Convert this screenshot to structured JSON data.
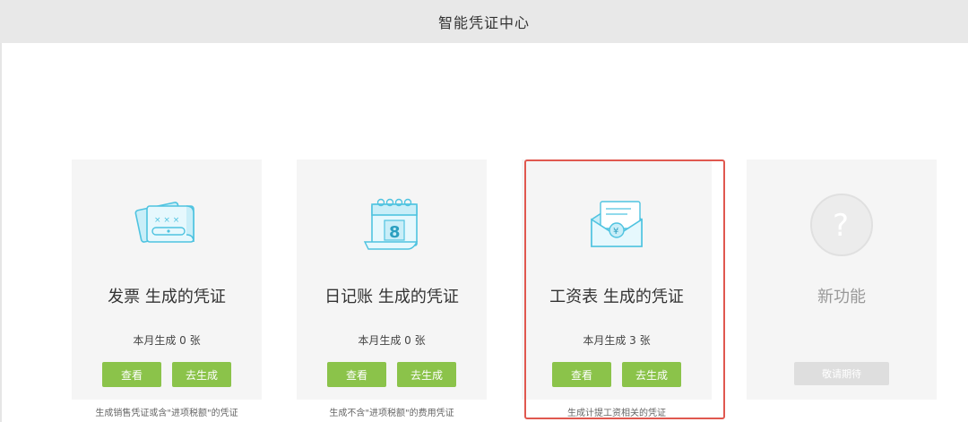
{
  "header": {
    "title": "智能凭证中心"
  },
  "cards": [
    {
      "title": "发票 生成的凭证",
      "count": "本月生成 0 张",
      "view_label": "查看",
      "generate_label": "去生成",
      "note": "生成销售凭证或含\"进项税额\"的凭证",
      "icon": "invoice-icon"
    },
    {
      "title": "日记账 生成的凭证",
      "count": "本月生成 0 张",
      "view_label": "查看",
      "generate_label": "去生成",
      "note": "生成不含\"进项税额\"的费用凭证",
      "icon": "calendar-icon"
    },
    {
      "title": "工资表 生成的凭证",
      "count": "本月生成 3 张",
      "view_label": "查看",
      "generate_label": "去生成",
      "note": "生成计提工资相关的凭证",
      "icon": "salary-envelope-icon"
    },
    {
      "title": "新功能",
      "coming_label": "敬请期待",
      "icon": "question-icon"
    }
  ],
  "colors": {
    "accent": "#8bc34a",
    "highlight": "#e0584f",
    "icon_stroke": "#4fc3e0",
    "icon_fill": "#c9eef8"
  }
}
